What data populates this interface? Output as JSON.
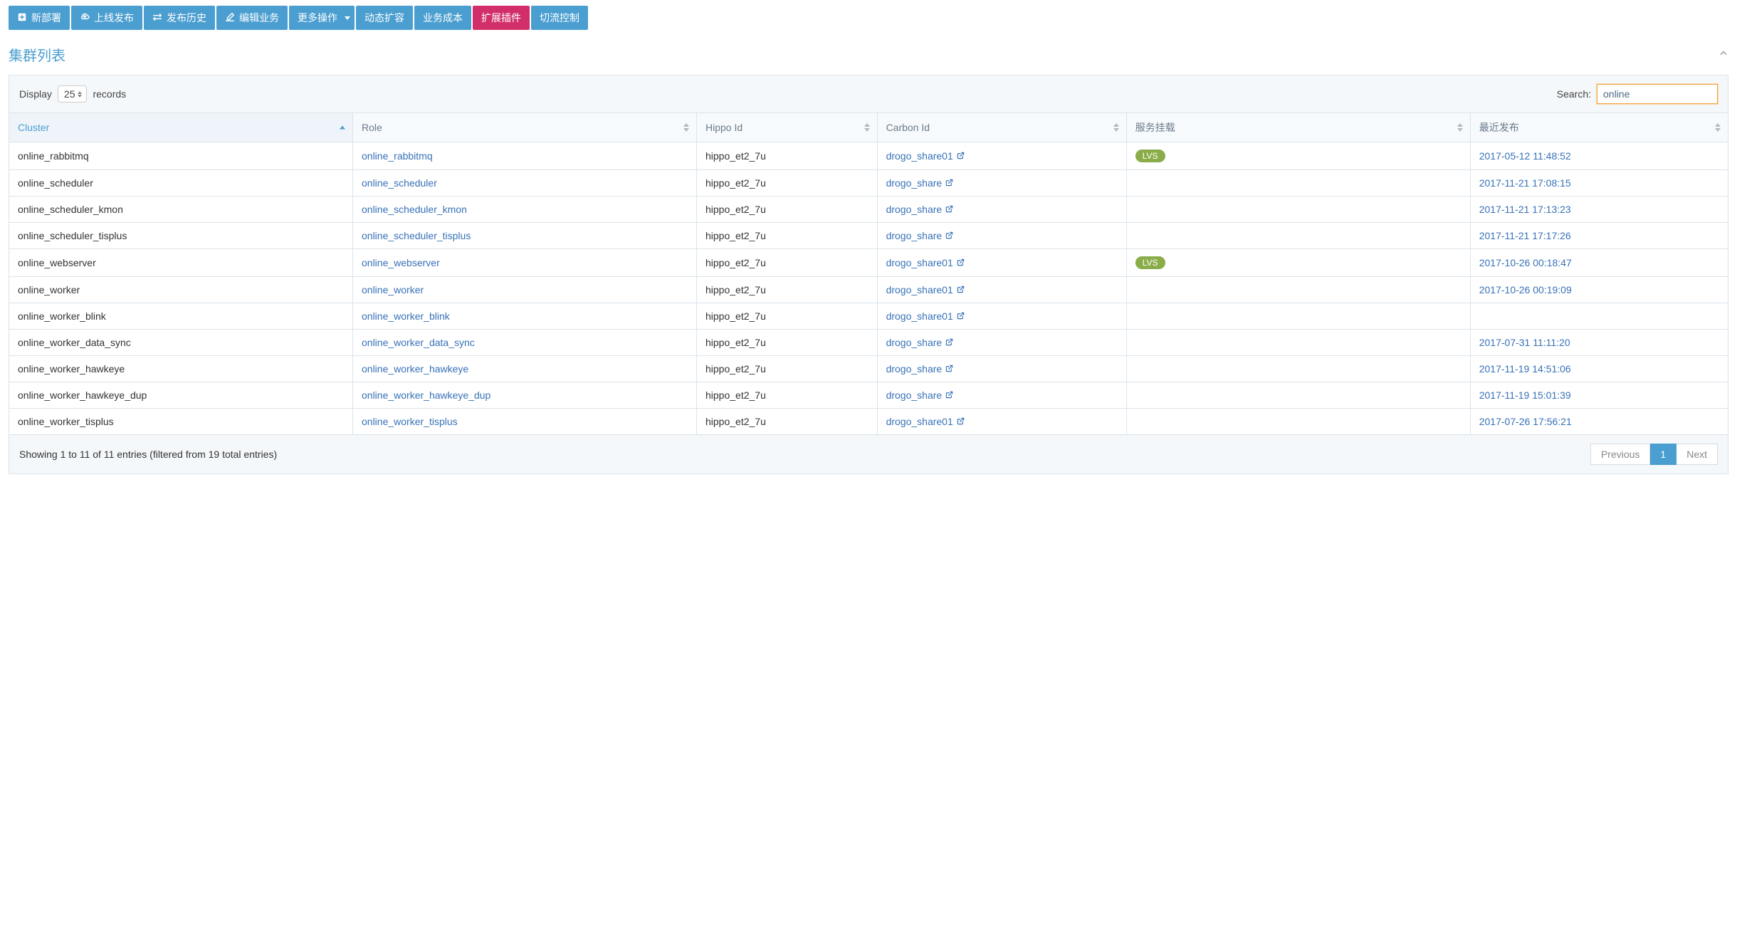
{
  "toolbar": [
    {
      "label": "新部署",
      "icon": "plus"
    },
    {
      "label": "上线发布",
      "icon": "cloud"
    },
    {
      "label": "发布历史",
      "icon": "exchange"
    },
    {
      "label": "编辑业务",
      "icon": "edit"
    },
    {
      "label": "更多操作",
      "dropdown": true
    },
    {
      "label": "动态扩容"
    },
    {
      "label": "业务成本"
    },
    {
      "label": "扩展插件",
      "active": true
    },
    {
      "label": "切流控制"
    }
  ],
  "panel_title": "集群列表",
  "display_label": "Display",
  "records_label": "records",
  "page_size": "25",
  "search_label": "Search:",
  "search_value": "online",
  "columns": [
    {
      "label": "Cluster",
      "sorted": "asc"
    },
    {
      "label": "Role"
    },
    {
      "label": "Hippo Id"
    },
    {
      "label": "Carbon Id"
    },
    {
      "label": "服务挂载"
    },
    {
      "label": "最近发布"
    }
  ],
  "lvs_badge": "LVS",
  "rows": [
    {
      "cluster": "online_rabbitmq",
      "role": "online_rabbitmq",
      "hippo": "hippo_et2_7u",
      "carbon": "drogo_share01",
      "svc": "LVS",
      "published": "2017-05-12 11:48:52"
    },
    {
      "cluster": "online_scheduler",
      "role": "online_scheduler",
      "hippo": "hippo_et2_7u",
      "carbon": "drogo_share",
      "svc": "",
      "published": "2017-11-21 17:08:15"
    },
    {
      "cluster": "online_scheduler_kmon",
      "role": "online_scheduler_kmon",
      "hippo": "hippo_et2_7u",
      "carbon": "drogo_share",
      "svc": "",
      "published": "2017-11-21 17:13:23"
    },
    {
      "cluster": "online_scheduler_tisplus",
      "role": "online_scheduler_tisplus",
      "hippo": "hippo_et2_7u",
      "carbon": "drogo_share",
      "svc": "",
      "published": "2017-11-21 17:17:26"
    },
    {
      "cluster": "online_webserver",
      "role": "online_webserver",
      "hippo": "hippo_et2_7u",
      "carbon": "drogo_share01",
      "svc": "LVS",
      "published": "2017-10-26 00:18:47"
    },
    {
      "cluster": "online_worker",
      "role": "online_worker",
      "hippo": "hippo_et2_7u",
      "carbon": "drogo_share01",
      "svc": "",
      "published": "2017-10-26 00:19:09"
    },
    {
      "cluster": "online_worker_blink",
      "role": "online_worker_blink",
      "hippo": "hippo_et2_7u",
      "carbon": "drogo_share01",
      "svc": "",
      "published": ""
    },
    {
      "cluster": "online_worker_data_sync",
      "role": "online_worker_data_sync",
      "hippo": "hippo_et2_7u",
      "carbon": "drogo_share",
      "svc": "",
      "published": "2017-07-31 11:11:20"
    },
    {
      "cluster": "online_worker_hawkeye",
      "role": "online_worker_hawkeye",
      "hippo": "hippo_et2_7u",
      "carbon": "drogo_share",
      "svc": "",
      "published": "2017-11-19 14:51:06"
    },
    {
      "cluster": "online_worker_hawkeye_dup",
      "role": "online_worker_hawkeye_dup",
      "hippo": "hippo_et2_7u",
      "carbon": "drogo_share",
      "svc": "",
      "published": "2017-11-19 15:01:39"
    },
    {
      "cluster": "online_worker_tisplus",
      "role": "online_worker_tisplus",
      "hippo": "hippo_et2_7u",
      "carbon": "drogo_share01",
      "svc": "",
      "published": "2017-07-26 17:56:21"
    }
  ],
  "footer_info": "Showing 1 to 11 of 11 entries (filtered from 19 total entries)",
  "pager": {
    "prev": "Previous",
    "page": "1",
    "next": "Next"
  }
}
